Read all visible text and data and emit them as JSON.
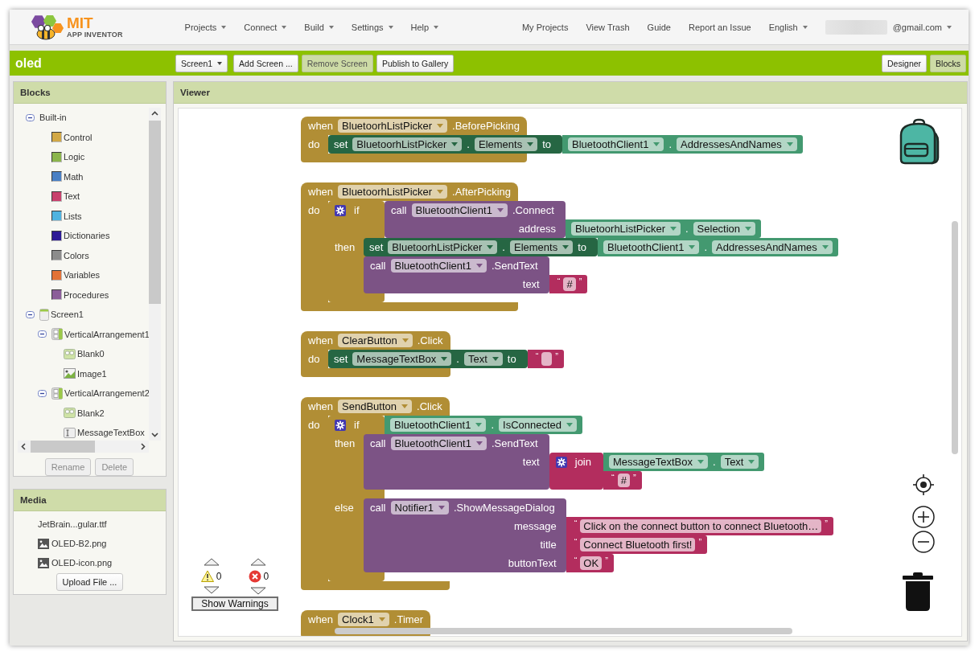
{
  "header": {
    "logo": {
      "title": "MIT",
      "subtitle": "APP INVENTOR"
    },
    "menus": [
      "Projects",
      "Connect",
      "Build",
      "Settings",
      "Help"
    ],
    "links": [
      "My Projects",
      "View Trash",
      "Guide",
      "Report an Issue"
    ],
    "language": "English",
    "account": "@gmail.com"
  },
  "project_bar": {
    "project_name": "oled",
    "screen": "Screen1",
    "buttons": [
      {
        "label": "Add Screen ...",
        "disabled": false
      },
      {
        "label": "Remove Screen",
        "disabled": true
      },
      {
        "label": "Publish to Gallery",
        "disabled": false
      }
    ],
    "views": [
      {
        "label": "Designer",
        "selected": false
      },
      {
        "label": "Blocks",
        "selected": true
      }
    ]
  },
  "blocks_panel": {
    "title": "Blocks",
    "tree": [
      {
        "label": "Built-in",
        "kind": "group",
        "expanded": true,
        "children": [
          {
            "label": "Control",
            "kind": "category",
            "color": "#d2a846"
          },
          {
            "label": "Logic",
            "kind": "category",
            "color": "#8bb54c"
          },
          {
            "label": "Math",
            "kind": "category",
            "color": "#4a80c4"
          },
          {
            "label": "Text",
            "kind": "category",
            "color": "#c8416d"
          },
          {
            "label": "Lists",
            "kind": "category",
            "color": "#4fb3e0"
          },
          {
            "label": "Dictionaries",
            "kind": "category",
            "color": "#2d1a96"
          },
          {
            "label": "Colors",
            "kind": "category",
            "color": "#8c8c8c"
          },
          {
            "label": "Variables",
            "kind": "category",
            "color": "#e27237"
          },
          {
            "label": "Procedures",
            "kind": "category",
            "color": "#8b5e99"
          }
        ]
      },
      {
        "label": "Screen1",
        "kind": "screen",
        "expanded": true,
        "children": [
          {
            "label": "VerticalArrangement1",
            "kind": "arrangement",
            "expanded": true,
            "children": [
              {
                "label": "Blank0",
                "kind": "tile"
              },
              {
                "label": "Image1",
                "kind": "image"
              }
            ]
          },
          {
            "label": "VerticalArrangement2",
            "kind": "arrangement",
            "expanded": true,
            "children": [
              {
                "label": "Blank2",
                "kind": "tile"
              },
              {
                "label": "MessageTextBox",
                "kind": "textbox"
              }
            ]
          }
        ]
      }
    ],
    "buttons": [
      {
        "label": "Rename",
        "disabled": true
      },
      {
        "label": "Delete",
        "disabled": true
      }
    ]
  },
  "media_panel": {
    "title": "Media",
    "files": [
      {
        "name": "JetBrain...gular.ttf",
        "kind": "font"
      },
      {
        "name": "OLED-B2.png",
        "kind": "image"
      },
      {
        "name": "OLED-icon.png",
        "kind": "image"
      }
    ],
    "upload_button": "Upload File ..."
  },
  "viewer": {
    "title": "Viewer",
    "blocks": [
      {
        "kind": "event",
        "fields": [
          {
            "kind": "label",
            "text": "when"
          },
          {
            "kind": "dropdown",
            "text": "BluetoorhListPicker"
          },
          {
            "kind": "label",
            "text": ".BeforePicking"
          }
        ],
        "inputs": [
          {
            "kind": "statement",
            "label": "do",
            "blocks": [
              {
                "kind": "setter",
                "fields": [
                  {
                    "kind": "label",
                    "text": "set"
                  },
                  {
                    "kind": "dropdown",
                    "text": "BluetoorhListPicker"
                  },
                  {
                    "kind": "label",
                    "text": "."
                  },
                  {
                    "kind": "dropdown",
                    "text": "Elements"
                  },
                  {
                    "kind": "label",
                    "text": "to"
                  }
                ],
                "value": {
                  "kind": "getter",
                  "fields": [
                    {
                      "kind": "dropdown",
                      "text": "BluetoothClient1"
                    },
                    {
                      "kind": "label",
                      "text": "."
                    },
                    {
                      "kind": "dropdown",
                      "text": "AddressesAndNames"
                    }
                  ]
                }
              }
            ]
          }
        ]
      },
      {
        "kind": "event",
        "fields": [
          {
            "kind": "label",
            "text": "when"
          },
          {
            "kind": "dropdown",
            "text": "BluetoorhListPicker"
          },
          {
            "kind": "label",
            "text": ".AfterPicking"
          }
        ],
        "inputs": [
          {
            "kind": "statement",
            "label": "do",
            "blocks": [
              {
                "kind": "if",
                "inputs": [
                  {
                    "kind": "value",
                    "label": "if",
                    "block": {
                      "kind": "call",
                      "fields": [
                        {
                          "kind": "label",
                          "text": "call"
                        },
                        {
                          "kind": "dropdown",
                          "text": "BluetoothClient1"
                        },
                        {
                          "kind": "label",
                          "text": ".Connect"
                        }
                      ],
                      "inputs": [
                        {
                          "kind": "value",
                          "label": "address",
                          "block": {
                            "kind": "getter",
                            "fields": [
                              {
                                "kind": "dropdown",
                                "text": "BluetoorhListPicker"
                              },
                              {
                                "kind": "label",
                                "text": "."
                              },
                              {
                                "kind": "dropdown",
                                "text": "Selection"
                              }
                            ]
                          }
                        }
                      ]
                    }
                  },
                  {
                    "kind": "statement",
                    "label": "then",
                    "blocks": [
                      {
                        "kind": "setter",
                        "fields": [
                          {
                            "kind": "label",
                            "text": "set"
                          },
                          {
                            "kind": "dropdown",
                            "text": "BluetoorhListPicker"
                          },
                          {
                            "kind": "label",
                            "text": "."
                          },
                          {
                            "kind": "dropdown",
                            "text": "Elements"
                          },
                          {
                            "kind": "label",
                            "text": "to"
                          }
                        ],
                        "value": {
                          "kind": "getter",
                          "fields": [
                            {
                              "kind": "dropdown",
                              "text": "BluetoothClient1"
                            },
                            {
                              "kind": "label",
                              "text": "."
                            },
                            {
                              "kind": "dropdown",
                              "text": "AddressesAndNames"
                            }
                          ]
                        }
                      },
                      {
                        "kind": "call",
                        "fields": [
                          {
                            "kind": "label",
                            "text": "call"
                          },
                          {
                            "kind": "dropdown",
                            "text": "BluetoothClient1"
                          },
                          {
                            "kind": "label",
                            "text": ".SendText"
                          }
                        ],
                        "inputs": [
                          {
                            "kind": "value",
                            "label": "text",
                            "block": {
                              "kind": "text",
                              "quotes": [
                                "“",
                                "”"
                              ],
                              "value": "#"
                            }
                          }
                        ]
                      }
                    ]
                  }
                ]
              }
            ]
          }
        ]
      },
      {
        "kind": "event",
        "fields": [
          {
            "kind": "label",
            "text": "when"
          },
          {
            "kind": "dropdown",
            "text": "ClearButton"
          },
          {
            "kind": "label",
            "text": ".Click"
          }
        ],
        "inputs": [
          {
            "kind": "statement",
            "label": "do",
            "blocks": [
              {
                "kind": "setter",
                "fields": [
                  {
                    "kind": "label",
                    "text": "set"
                  },
                  {
                    "kind": "dropdown",
                    "text": "MessageTextBox"
                  },
                  {
                    "kind": "label",
                    "text": "."
                  },
                  {
                    "kind": "dropdown",
                    "text": "Text"
                  },
                  {
                    "kind": "label",
                    "text": "to"
                  }
                ],
                "value": {
                  "kind": "text",
                  "quotes": [
                    "“",
                    "”"
                  ]
                }
              }
            ]
          }
        ]
      },
      {
        "kind": "event",
        "fields": [
          {
            "kind": "label",
            "text": "when"
          },
          {
            "kind": "dropdown",
            "text": "SendButton"
          },
          {
            "kind": "label",
            "text": ".Click"
          }
        ],
        "inputs": [
          {
            "kind": "statement",
            "label": "do",
            "blocks": [
              {
                "kind": "if",
                "inputs": [
                  {
                    "kind": "value",
                    "label": "if",
                    "block": {
                      "kind": "getter",
                      "fields": [
                        {
                          "kind": "dropdown",
                          "text": "BluetoothClient1"
                        },
                        {
                          "kind": "label",
                          "text": "."
                        },
                        {
                          "kind": "dropdown",
                          "text": "IsConnected"
                        }
                      ]
                    }
                  },
                  {
                    "kind": "statement",
                    "label": "then",
                    "blocks": [
                      {
                        "kind": "call",
                        "fields": [
                          {
                            "kind": "label",
                            "text": "call"
                          },
                          {
                            "kind": "dropdown",
                            "text": "BluetoothClient1"
                          },
                          {
                            "kind": "label",
                            "text": ".SendText"
                          }
                        ],
                        "inputs": [
                          {
                            "kind": "value",
                            "label": "text",
                            "block": {
                              "kind": "join",
                              "inputs": [
                                {
                                  "kind": "value",
                                  "label": "join",
                                  "block": {
                                    "kind": "getter",
                                    "fields": [
                                      {
                                        "kind": "dropdown",
                                        "text": "MessageTextBox"
                                      },
                                      {
                                        "kind": "label",
                                        "text": "."
                                      },
                                      {
                                        "kind": "dropdown",
                                        "text": "Text"
                                      }
                                    ]
                                  }
                                },
                                {
                                  "kind": "value",
                                  "block": {
                                    "kind": "text",
                                    "quotes": [
                                      "“",
                                      "”"
                                    ],
                                    "value": "#"
                                  }
                                }
                              ]
                            }
                          }
                        ]
                      }
                    ]
                  },
                  {
                    "kind": "statement",
                    "label": "else",
                    "blocks": [
                      {
                        "kind": "call",
                        "fields": [
                          {
                            "kind": "label",
                            "text": "call"
                          },
                          {
                            "kind": "dropdown",
                            "text": "Notifier1"
                          },
                          {
                            "kind": "label",
                            "text": ".ShowMessageDialog"
                          }
                        ],
                        "inputs": [
                          {
                            "kind": "value",
                            "label": "message",
                            "block": {
                              "kind": "text",
                              "quotes": [
                                "“",
                                "”"
                              ],
                              "value": "Click on the connect button to connect Bluetooth…"
                            }
                          },
                          {
                            "kind": "value",
                            "label": "title",
                            "block": {
                              "kind": "text",
                              "quotes": [
                                "“",
                                "”"
                              ],
                              "value": "Connect Bluetooth first!"
                            }
                          },
                          {
                            "kind": "value",
                            "label": "buttonText",
                            "block": {
                              "kind": "text",
                              "quotes": [
                                "“",
                                "”"
                              ],
                              "value": "OK"
                            }
                          }
                        ]
                      }
                    ]
                  }
                ]
              }
            ]
          }
        ]
      },
      {
        "kind": "event",
        "fields": [
          {
            "kind": "label",
            "text": "when"
          },
          {
            "kind": "dropdown",
            "text": "Clock1"
          },
          {
            "kind": "label",
            "text": ".Timer"
          }
        ]
      }
    ],
    "warnings": {
      "warning_count": "0",
      "error_count": "0",
      "toggle_label": "Show Warnings"
    }
  }
}
